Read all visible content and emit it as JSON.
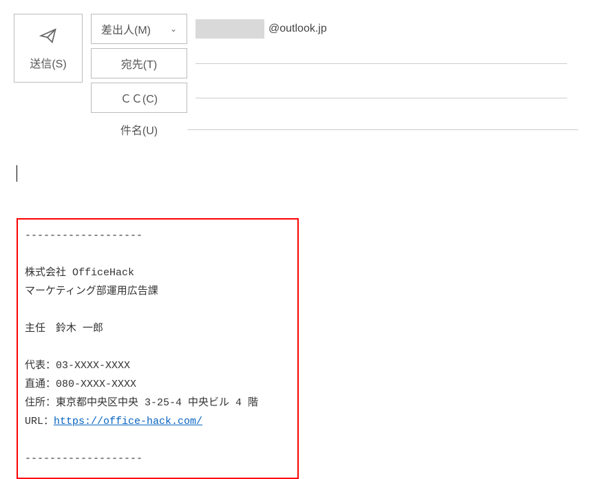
{
  "send": {
    "label": "送信(S)"
  },
  "from": {
    "label": "差出人(M)",
    "domain": "@outlook.jp"
  },
  "to": {
    "label": "宛先(T)"
  },
  "cc": {
    "label": "ＣＣ(C)"
  },
  "subject": {
    "label": "件名(U)"
  },
  "signature": {
    "divider_top": "-------------------",
    "company": "株式会社 OfficeHack",
    "department": "マーケティング部運用広告課",
    "title_name": "主任　鈴木 一郎",
    "tel_main": "代表：03-XXXX-XXXX",
    "tel_direct": "直通：080-XXXX-XXXX",
    "address": "住所：東京都中央区中央 3-25-4 中央ビル 4 階",
    "url_label": "URL：",
    "url": "https://office-hack.com/",
    "divider_bottom": "-------------------"
  }
}
